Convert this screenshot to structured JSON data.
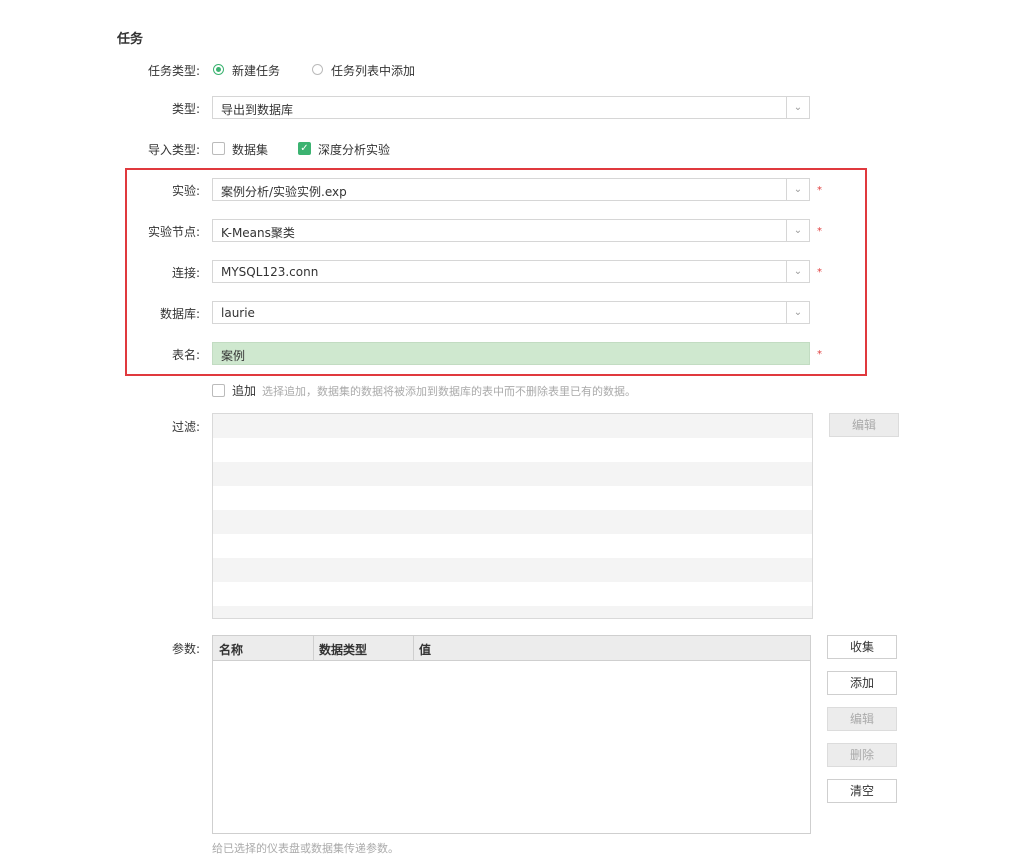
{
  "section_title": "任务",
  "task_type": {
    "label": "任务类型:",
    "options": [
      "新建任务",
      "任务列表中添加"
    ],
    "selected": "新建任务"
  },
  "type": {
    "label": "类型:",
    "value": "导出到数据库"
  },
  "import_type": {
    "label": "导入类型:",
    "options": [
      {
        "label": "数据集",
        "checked": false
      },
      {
        "label": "深度分析实验",
        "checked": true
      }
    ]
  },
  "experiment": {
    "label": "实验:",
    "value": "案例分析/实验实例.exp",
    "required": "*"
  },
  "experiment_node": {
    "label": "实验节点:",
    "value": "K-Means聚类",
    "required": "*"
  },
  "connection": {
    "label": "连接:",
    "value": "MYSQL123.conn",
    "required": "*"
  },
  "database": {
    "label": "数据库:",
    "value": "laurie"
  },
  "table_name": {
    "label": "表名:",
    "value": "案例",
    "required": "*",
    "bg_color": "#cfe8cf"
  },
  "append": {
    "label": "追加",
    "hint": "选择追加，数据集的数据将被添加到数据库的表中而不删除表里已有的数据。",
    "checked": false
  },
  "filter": {
    "label": "过滤:",
    "edit_button": "编辑"
  },
  "params": {
    "label": "参数:",
    "columns": [
      "名称",
      "数据类型",
      "值"
    ],
    "buttons": {
      "collect": "收集",
      "add": "添加",
      "edit": "编辑",
      "delete": "删除",
      "clear": "清空"
    },
    "hint": "给已选择的仪表盘或数据集传递参数。"
  },
  "colors": {
    "accent": "#3cb371",
    "required": "#e04040",
    "highlight_border": "#e0393e"
  }
}
